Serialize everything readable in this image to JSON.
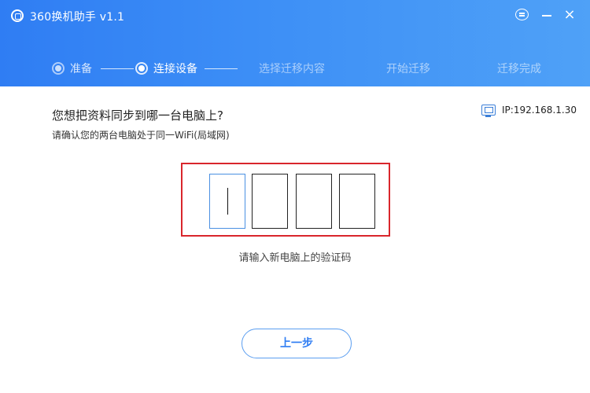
{
  "app": {
    "title": "360换机助手 v1.1"
  },
  "titlebar": {
    "close_glyph": "×",
    "icons": [
      "app-logo-icon",
      "chat-icon",
      "minimize-icon",
      "close-icon"
    ]
  },
  "steps": [
    {
      "label": "准备",
      "state": "done"
    },
    {
      "label": "连接设备",
      "state": "active"
    },
    {
      "label": "选择迁移内容",
      "state": "pending"
    },
    {
      "label": "开始迁移",
      "state": "pending"
    },
    {
      "label": "迁移完成",
      "state": "pending"
    }
  ],
  "main": {
    "question": "您想把资料同步到哪一台电脑上?",
    "subtext": "请确认您的两台电脑处于同一WiFi(局域网)",
    "ip": "IP:192.168.1.30",
    "code_values": [
      "",
      "",
      "",
      ""
    ],
    "hint": "请输入新电脑上的验证码",
    "prev_button": "上一步"
  },
  "colors": {
    "header_start": "#2f7df3",
    "header_end": "#4fa1f7",
    "highlight_frame": "#d9262c",
    "accent": "#2f7df3"
  }
}
